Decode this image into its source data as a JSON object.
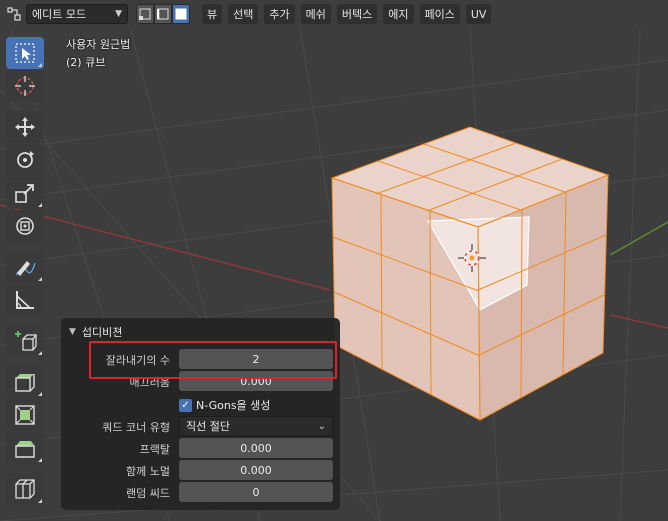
{
  "header": {
    "editor_icon": "editor-type-icon",
    "mode": "에디트 모드",
    "select_modes": [
      "vertex",
      "edge",
      "face"
    ],
    "menus": [
      "뷰",
      "선택",
      "추가",
      "메쉬",
      "버텍스",
      "에지",
      "페이스",
      "UV"
    ]
  },
  "overlay": {
    "view_name": "사용자 원근법",
    "object_info": "(2) 큐브"
  },
  "toolbar": {
    "tools": [
      "select-box",
      "cursor",
      "move",
      "rotate",
      "scale",
      "transform",
      "annotate",
      "measure",
      "add-cube",
      "extrude",
      "inset",
      "bevel",
      "loop-cut"
    ]
  },
  "panel": {
    "title": "섭디비젼",
    "cuts_label": "잘라내기의 수",
    "cuts_value": "2",
    "smoothness_label": "매끄러움",
    "smoothness_value": "0.000",
    "ngons_label": "N-Gons을 생성",
    "ngons_checked": true,
    "quad_corner_label": "쿼드 코너 유형",
    "quad_corner_value": "직선 절단",
    "fractal_label": "프랙탈",
    "fractal_value": "0.000",
    "along_normal_label": "함께 노멀",
    "along_normal_value": "0.000",
    "random_seed_label": "랜덤 씨드",
    "random_seed_value": "0"
  },
  "colors": {
    "accent": "#4772b3",
    "highlight": "#e0202a",
    "cube_face": "#e8c8bd",
    "cube_edge": "#f08a20",
    "selected_face": "#ffffff"
  }
}
